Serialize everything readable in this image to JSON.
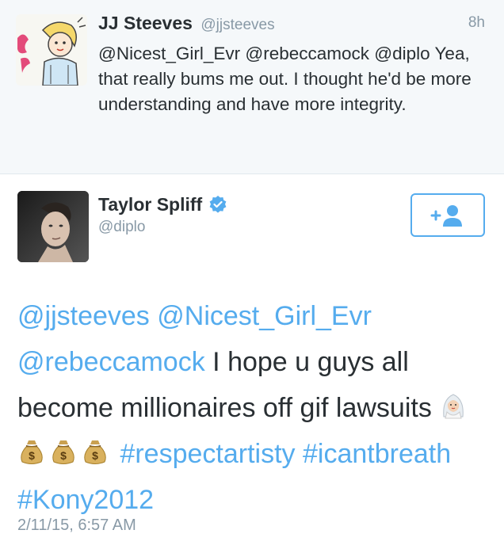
{
  "reply_tweet": {
    "display_name": "JJ Steeves",
    "handle": "@jjsteeves",
    "time": "8h",
    "text": "@Nicest_Girl_Evr @rebeccamock @diplo Yea, that really bums me out. I thought he'd be more understanding and have more integrity."
  },
  "main_tweet": {
    "display_name": "Taylor Spliff",
    "handle": "@diplo",
    "verified": true,
    "follow_icon": "add-user-icon",
    "mention_1": "@jjsteeves",
    "mention_2": "@Nicest_Girl_Evr",
    "mention_3": "@rebeccamock",
    "body": "I hope u guys all become millionaires off gif lawsuits",
    "emojis": [
      "bride-emoji",
      "money-bag-emoji",
      "money-bag-emoji",
      "money-bag-emoji"
    ],
    "hashtag_1": "#respectartisty",
    "hashtag_2": "#icantbreath",
    "hashtag_3": "#Kony2012",
    "timestamp": "2/11/15, 6:57 AM"
  },
  "colors": {
    "link": "#55acee",
    "secondary_text": "#8899a6",
    "reply_background": "#f5f8fa",
    "verified_badge": "#55acee"
  }
}
